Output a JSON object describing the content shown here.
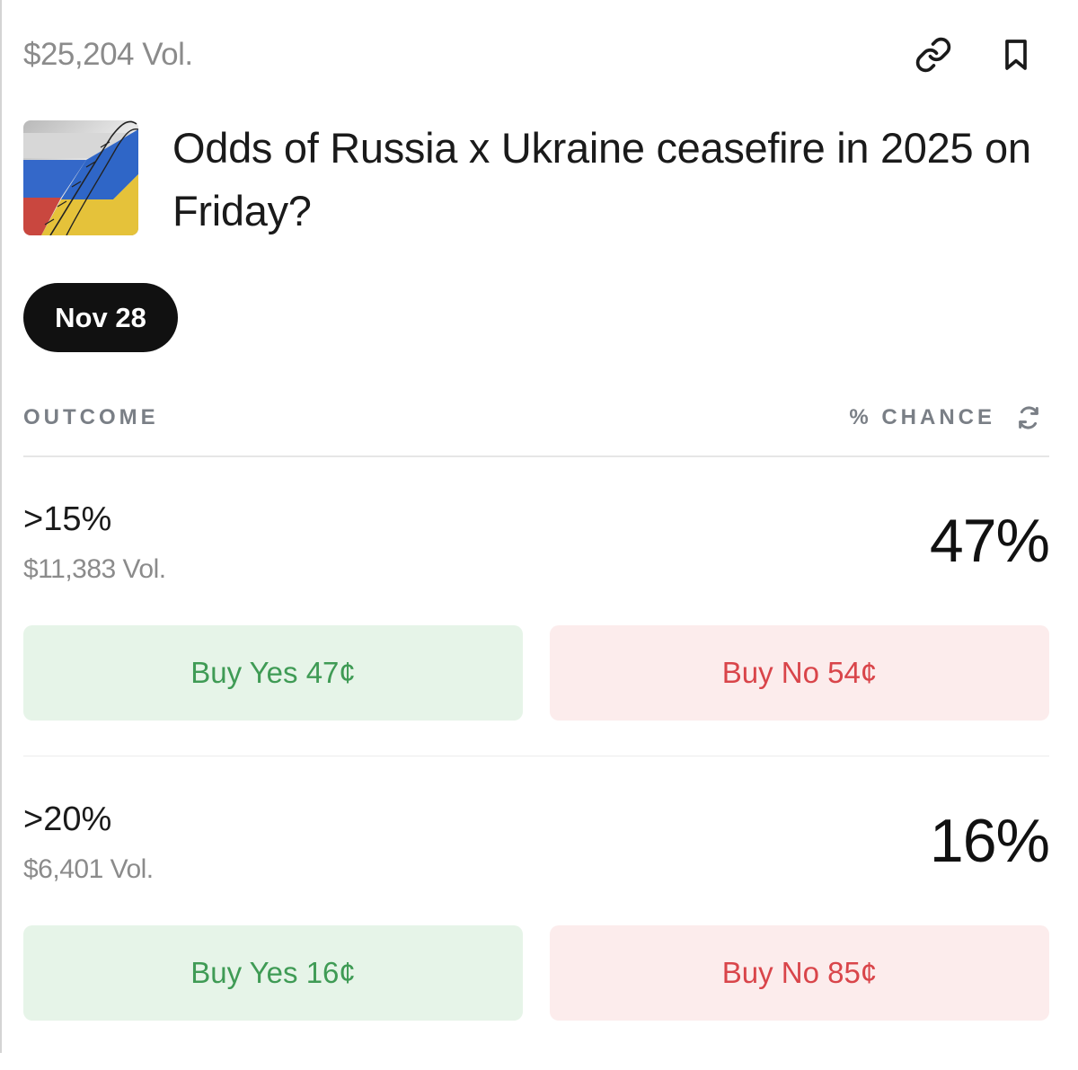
{
  "market": {
    "total_volume": "$25,204 Vol.",
    "title": "Odds of Russia x Ukraine ceasefire in 2025 on Friday?",
    "date_chip": "Nov 28",
    "icons": {
      "link": "link-icon",
      "bookmark": "bookmark-icon",
      "refresh": "refresh-icon",
      "thumbnail": "flag-thumbnail"
    }
  },
  "table": {
    "outcome_header": "OUTCOME",
    "chance_header": "% CHANCE"
  },
  "outcomes": [
    {
      "label": ">15%",
      "volume": "$11,383 Vol.",
      "chance": "47%",
      "buy_yes": "Buy Yes 47¢",
      "buy_no": "Buy No 54¢"
    },
    {
      "label": ">20%",
      "volume": "$6,401 Vol.",
      "chance": "16%",
      "buy_yes": "Buy Yes 16¢",
      "buy_no": "Buy No 85¢"
    }
  ],
  "colors": {
    "yes_text": "#3f9b55",
    "yes_bg": "#e6f4e8",
    "no_text": "#d9454a",
    "no_bg": "#fcecec",
    "chip_bg": "#111111"
  }
}
